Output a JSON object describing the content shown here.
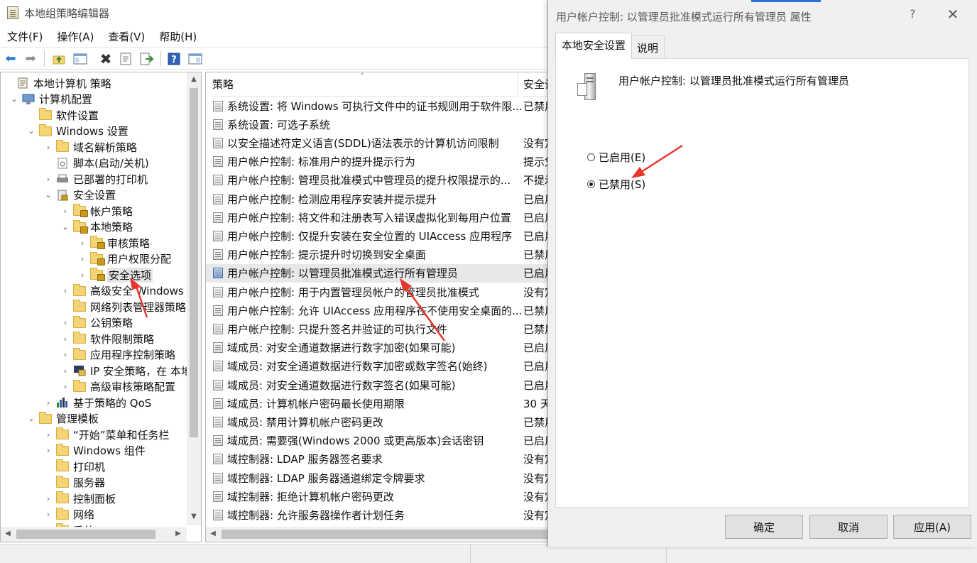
{
  "window": {
    "title": "本地组策略编辑器"
  },
  "menu": [
    "文件(F)",
    "操作(A)",
    "查看(V)",
    "帮助(H)"
  ],
  "toolbar": {
    "back": "back-icon",
    "forward": "forward-icon",
    "up": "up-folder-icon",
    "show_hide": "show-hide-tree-icon",
    "delete": "delete-icon",
    "properties": "properties-icon",
    "export": "export-list-icon",
    "help": "help-icon",
    "view": "view-icon"
  },
  "tree": [
    {
      "label": "本地计算机 策略",
      "depth": 0,
      "icon": "policy-doc-icon",
      "chevron": ""
    },
    {
      "label": "计算机配置",
      "depth": 1,
      "icon": "computer-icon",
      "chevron": "⌄"
    },
    {
      "label": "软件设置",
      "depth": 2,
      "icon": "folder-icon",
      "chevron": ""
    },
    {
      "label": "Windows 设置",
      "depth": 2,
      "icon": "folder-icon",
      "chevron": "⌄"
    },
    {
      "label": "域名解析策略",
      "depth": 3,
      "icon": "folder-icon",
      "chevron": "›"
    },
    {
      "label": "脚本(启动/关机)",
      "depth": 3,
      "icon": "script-icon",
      "chevron": ""
    },
    {
      "label": "已部署的打印机",
      "depth": 3,
      "icon": "printer-icon",
      "chevron": "›"
    },
    {
      "label": "安全设置",
      "depth": 3,
      "icon": "security-settings-icon",
      "chevron": "⌄"
    },
    {
      "label": "帐户策略",
      "depth": 4,
      "icon": "folder-lock-icon",
      "chevron": "›"
    },
    {
      "label": "本地策略",
      "depth": 4,
      "icon": "folder-lock-icon",
      "chevron": "⌄"
    },
    {
      "label": "审核策略",
      "depth": 5,
      "icon": "folder-lock-icon",
      "chevron": "›"
    },
    {
      "label": "用户权限分配",
      "depth": 5,
      "icon": "folder-lock-icon",
      "chevron": "›"
    },
    {
      "label": "安全选项",
      "depth": 5,
      "icon": "folder-lock-icon",
      "chevron": "›",
      "selected": true
    },
    {
      "label": "高级安全 Windows D",
      "depth": 4,
      "icon": "folder-icon",
      "chevron": "›"
    },
    {
      "label": "网络列表管理器策略",
      "depth": 4,
      "icon": "folder-icon",
      "chevron": ""
    },
    {
      "label": "公钥策略",
      "depth": 4,
      "icon": "folder-icon",
      "chevron": "›"
    },
    {
      "label": "软件限制策略",
      "depth": 4,
      "icon": "folder-icon",
      "chevron": "›"
    },
    {
      "label": "应用程序控制策略",
      "depth": 4,
      "icon": "folder-icon",
      "chevron": "›"
    },
    {
      "label": "IP 安全策略，在 本地",
      "depth": 4,
      "icon": "ip-security-icon",
      "chevron": "›"
    },
    {
      "label": "高级审核策略配置",
      "depth": 4,
      "icon": "folder-icon",
      "chevron": "›"
    },
    {
      "label": "基于策略的 QoS",
      "depth": 3,
      "icon": "qos-chart-icon",
      "chevron": "›"
    },
    {
      "label": "管理模板",
      "depth": 2,
      "icon": "folder-icon",
      "chevron": "⌄"
    },
    {
      "label": "“开始”菜单和任务栏",
      "depth": 3,
      "icon": "folder-icon",
      "chevron": "›"
    },
    {
      "label": "Windows 组件",
      "depth": 3,
      "icon": "folder-icon",
      "chevron": "›"
    },
    {
      "label": "打印机",
      "depth": 3,
      "icon": "folder-icon",
      "chevron": ""
    },
    {
      "label": "服务器",
      "depth": 3,
      "icon": "folder-icon",
      "chevron": ""
    },
    {
      "label": "控制面板",
      "depth": 3,
      "icon": "folder-icon",
      "chevron": "›"
    },
    {
      "label": "网络",
      "depth": 3,
      "icon": "folder-icon",
      "chevron": "›"
    },
    {
      "label": "系统",
      "depth": 3,
      "icon": "folder-icon",
      "chevron": "›"
    }
  ],
  "list": {
    "columns": {
      "policy": "策略",
      "setting": "安全设"
    },
    "rows": [
      {
        "name": "系统设置: 将 Windows 可执行文件中的证书规则用于软件限...",
        "setting": "已禁用"
      },
      {
        "name": "系统设置: 可选子系统",
        "setting": ""
      },
      {
        "name": "以安全描述符定义语言(SDDL)语法表示的计算机访问限制",
        "setting": "没有定"
      },
      {
        "name": "用户帐户控制: 标准用户的提升提示行为",
        "setting": "提示凭"
      },
      {
        "name": "用户帐户控制: 管理员批准模式中管理员的提升权限提示的...",
        "setting": "不提示"
      },
      {
        "name": "用户帐户控制: 检测应用程序安装并提示提升",
        "setting": "已启用"
      },
      {
        "name": "用户帐户控制: 将文件和注册表写入错误虚拟化到每用户位置",
        "setting": "已启用"
      },
      {
        "name": "用户帐户控制: 仅提升安装在安全位置的 UIAccess 应用程序",
        "setting": "已启用"
      },
      {
        "name": "用户帐户控制: 提示提升时切换到安全桌面",
        "setting": "已禁用"
      },
      {
        "name": "用户帐户控制: 以管理员批准模式运行所有管理员",
        "setting": "已启用",
        "selected": true
      },
      {
        "name": "用户帐户控制: 用于内置管理员帐户的管理员批准模式",
        "setting": "没有定"
      },
      {
        "name": "用户帐户控制: 允许 UIAccess 应用程序在不使用安全桌面的...",
        "setting": "已禁用"
      },
      {
        "name": "用户帐户控制: 只提升签名并验证的可执行文件",
        "setting": "已禁用"
      },
      {
        "name": "域成员: 对安全通道数据进行数字加密(如果可能)",
        "setting": "已启用"
      },
      {
        "name": "域成员: 对安全通道数据进行数字加密或数字签名(始终)",
        "setting": "已启用"
      },
      {
        "name": "域成员: 对安全通道数据进行数字签名(如果可能)",
        "setting": "已启用"
      },
      {
        "name": "域成员: 计算机帐户密码最长使用期限",
        "setting": "30 天"
      },
      {
        "name": "域成员: 禁用计算机帐户密码更改",
        "setting": "已禁用"
      },
      {
        "name": "域成员: 需要强(Windows 2000 或更高版本)会话密钥",
        "setting": "已启用"
      },
      {
        "name": "域控制器: LDAP 服务器签名要求",
        "setting": "没有定"
      },
      {
        "name": "域控制器: LDAP 服务器通道绑定令牌要求",
        "setting": "没有定"
      },
      {
        "name": "域控制器: 拒绝计算机帐户密码更改",
        "setting": "没有定"
      },
      {
        "name": "域控制器: 允许服务器操作者计划任务",
        "setting": "没有定"
      }
    ]
  },
  "dialog": {
    "title": "用户帐户控制: 以管理员批准模式运行所有管理员 属性",
    "help": "?",
    "close": "✕",
    "tabs": [
      "本地安全设置",
      "说明"
    ],
    "policy_name": "用户帐户控制: 以管理员批准模式运行所有管理员",
    "options": [
      {
        "label": "已启用(E)",
        "checked": false
      },
      {
        "label": "已禁用(S)",
        "checked": true
      }
    ],
    "buttons": {
      "ok": "确定",
      "cancel": "取消",
      "apply": "应用(A)"
    }
  },
  "colors": {
    "accent": "#2b6ed9",
    "annotation_arrow": "#e8352c",
    "selection": "#e8e8e8"
  }
}
